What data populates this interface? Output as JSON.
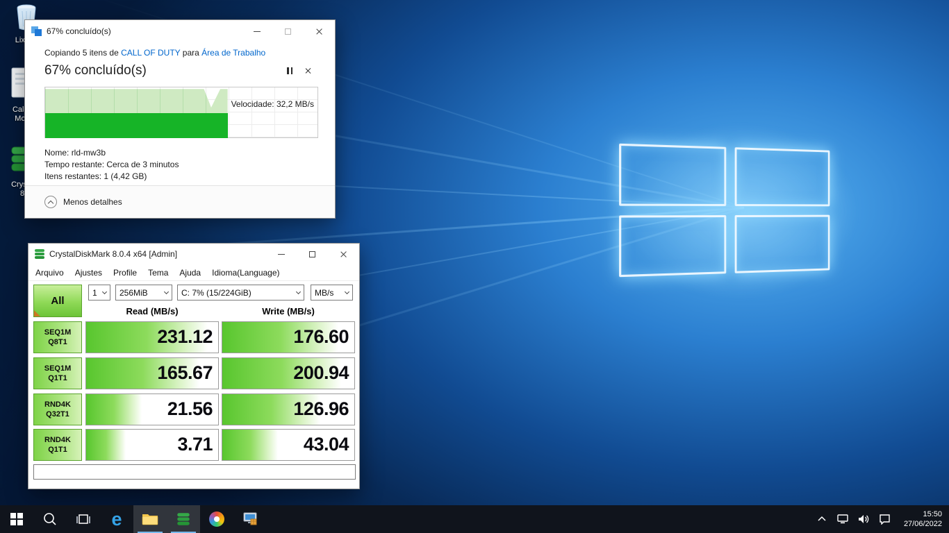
{
  "desktop": {
    "icons": [
      {
        "name": "recycle-bin",
        "label": "Lixeira"
      },
      {
        "name": "call-of-duty-file",
        "label_line1": "Call o",
        "label_line2": "Mod"
      },
      {
        "name": "crystaldiskmark-shortcut",
        "label_line1": "Crysta",
        "label_line2": "8"
      }
    ]
  },
  "copy_dialog": {
    "title": "67% concluído(s)",
    "copy_line": {
      "prefix": "Copiando 5 itens de ",
      "source_link": "CALL OF DUTY",
      "middle": " para ",
      "dest_link": "Área de Trabalho"
    },
    "heading": "67% concluído(s)",
    "progress_percent": 67,
    "speed_label": "Velocidade: 32,2 MB/s",
    "details": [
      {
        "label": "Nome:",
        "value": "rld-mw3b"
      },
      {
        "label": "Tempo restante:",
        "value": "Cerca de 3 minutos"
      },
      {
        "label": "Itens restantes:",
        "value": "1 (4,42 GB)"
      }
    ],
    "less_details_label": "Menos detalhes",
    "window_controls": [
      "minimize",
      "maximize",
      "close"
    ],
    "inline_controls": [
      "pause",
      "cancel"
    ]
  },
  "cdm": {
    "title": "CrystalDiskMark 8.0.4 x64 [Admin]",
    "menu": [
      "Arquivo",
      "Ajustes",
      "Profile",
      "Tema",
      "Ajuda",
      "Idioma(Language)"
    ],
    "all_label": "All",
    "test_count": "1",
    "test_size": "256MiB",
    "drive": "C: 7% (15/224GiB)",
    "unit": "MB/s",
    "read_header": "Read (MB/s)",
    "write_header": "Write (MB/s)",
    "rows": [
      {
        "l1": "SEQ1M",
        "l2": "Q8T1",
        "read": "231.12",
        "write": "176.60",
        "read_pct": 92,
        "write_pct": 88
      },
      {
        "l1": "SEQ1M",
        "l2": "Q1T1",
        "read": "165.67",
        "write": "200.94",
        "read_pct": 86,
        "write_pct": 90
      },
      {
        "l1": "RND4K",
        "l2": "Q32T1",
        "read": "21.56",
        "write": "126.96",
        "read_pct": 42,
        "write_pct": 74
      },
      {
        "l1": "RND4K",
        "l2": "Q1T1",
        "read": "3.71",
        "write": "43.04",
        "read_pct": 30,
        "write_pct": 42
      }
    ],
    "comment_value": "",
    "window_controls": [
      "minimize",
      "maximize",
      "close"
    ]
  },
  "taskbar": {
    "icons": [
      "start",
      "search",
      "task-view",
      "edge",
      "file-explorer",
      "crystaldiskmark",
      "paint-3d",
      "installer"
    ],
    "tray_icons": [
      "hidden-icons-chevron",
      "network",
      "volume",
      "action-center"
    ],
    "time": "15:50",
    "date": "27/06/2022"
  }
}
